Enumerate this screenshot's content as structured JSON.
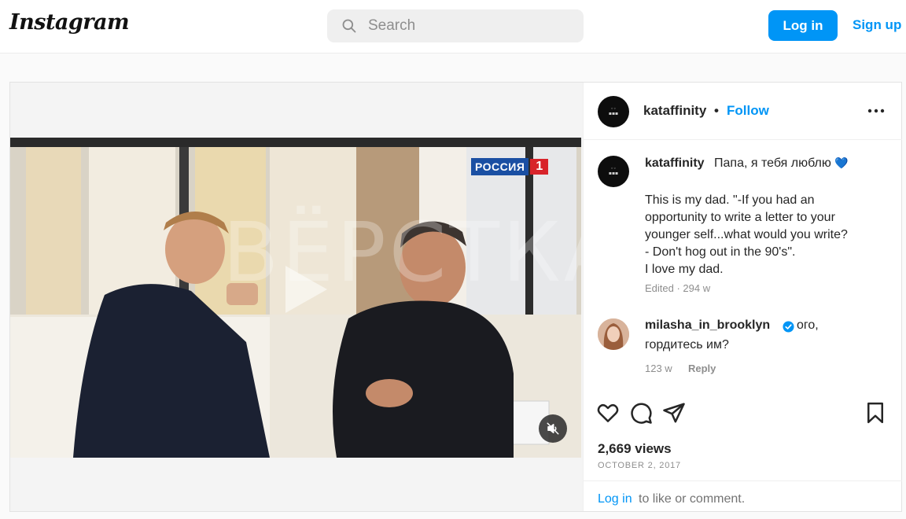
{
  "header": {
    "logo": "Instagram",
    "search_placeholder": "Search",
    "login_label": "Log in",
    "signup_label": "Sign up"
  },
  "video": {
    "channel_badge": "РОССИЯ",
    "channel_number": "1",
    "watermark": "ВЁРСТКА"
  },
  "post": {
    "username": "kataffinity",
    "separator": "•",
    "follow_label": "Follow",
    "caption_title": "Папа, я тебя люблю",
    "caption_heart": "💙",
    "caption_body": "This is my dad. \"-If you had an\nopportunity to write a letter to your\nyounger self...what would you write?\n- Don't hog out in the 90's\".\nI love my dad.",
    "caption_meta": "Edited · 294 w",
    "views": "2,669 views",
    "date": "OCTOBER 2, 2017",
    "footer_login": "Log in",
    "footer_rest": "to like or comment."
  },
  "comment": {
    "username": "milasha_in_brooklyn",
    "text_line1": "ого,",
    "text_line2": "гордитесь им?",
    "age": "123 w",
    "reply_label": "Reply"
  },
  "icons": {
    "search": "search-icon",
    "like": "heart-icon",
    "comment": "comment-icon",
    "share": "send-icon",
    "save": "bookmark-icon",
    "more": "more-icon",
    "mute": "muted-speaker-icon",
    "play": "play-icon",
    "verified": "verified-badge-icon"
  },
  "colors": {
    "accent": "#0095f6",
    "text": "#262626",
    "muted": "#8e8e8e"
  }
}
